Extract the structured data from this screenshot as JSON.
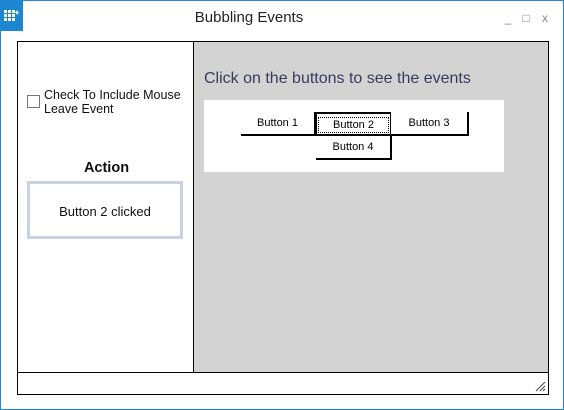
{
  "window": {
    "title": "Bubbling Events",
    "controls": {
      "minimize": "_",
      "maximize": "□",
      "close": "x"
    },
    "icon": "grid-app-icon"
  },
  "left_pane": {
    "checkbox_label": "Check To Include Mouse Leave Event",
    "checkbox_checked": false,
    "action_heading": "Action",
    "action_text": "Button 2 clicked"
  },
  "right_pane": {
    "instructions": "Click on the buttons to see the events",
    "buttons": [
      {
        "label": "Button 1",
        "focused": false
      },
      {
        "label": "Button 2",
        "focused": true
      },
      {
        "label": "Button 3",
        "focused": false
      },
      {
        "label": "Button 4",
        "focused": false
      }
    ]
  },
  "status_bar": {
    "text": ""
  },
  "colors": {
    "accent": "#1c86d0",
    "pane_background": "#d3d3d3",
    "instructions_text": "#3a3a5c",
    "action_border": "#c8d2e4"
  }
}
